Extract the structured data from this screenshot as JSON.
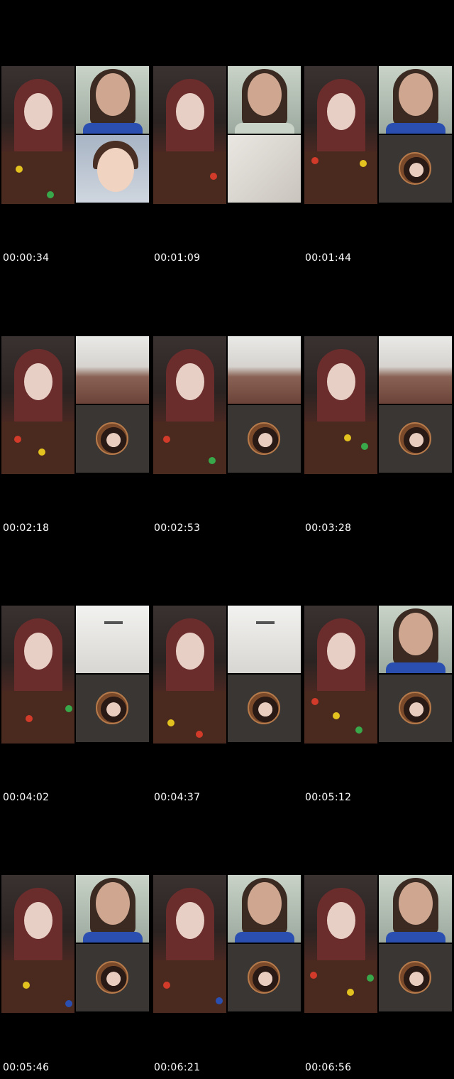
{
  "thumbnails": [
    {
      "timestamp": "00:00:34",
      "top_tile": "person",
      "bottom_tile": "cartoon"
    },
    {
      "timestamp": "00:01:09",
      "top_tile": "person",
      "bottom_tile": "ceiling"
    },
    {
      "timestamp": "00:01:44",
      "top_tile": "person",
      "bottom_tile": "avatar"
    },
    {
      "timestamp": "00:02:18",
      "top_tile": "skin",
      "bottom_tile": "avatar"
    },
    {
      "timestamp": "00:02:53",
      "top_tile": "skin",
      "bottom_tile": "avatar"
    },
    {
      "timestamp": "00:03:28",
      "top_tile": "skin",
      "bottom_tile": "avatar"
    },
    {
      "timestamp": "00:04:02",
      "top_tile": "wall",
      "bottom_tile": "avatar"
    },
    {
      "timestamp": "00:04:37",
      "top_tile": "wall",
      "bottom_tile": "avatar"
    },
    {
      "timestamp": "00:05:12",
      "top_tile": "person",
      "bottom_tile": "avatar"
    },
    {
      "timestamp": "00:05:46",
      "top_tile": "person",
      "bottom_tile": "avatar"
    },
    {
      "timestamp": "00:06:21",
      "top_tile": "person",
      "bottom_tile": "avatar"
    },
    {
      "timestamp": "00:06:56",
      "top_tile": "person",
      "bottom_tile": "avatar"
    }
  ],
  "colors": {
    "background": "#000000",
    "timestamp_text": "#ffffff",
    "avatar_tile": "#3a3634",
    "shirt_brown": "#4a2a1e",
    "hair_red": "#6b2c2c"
  }
}
